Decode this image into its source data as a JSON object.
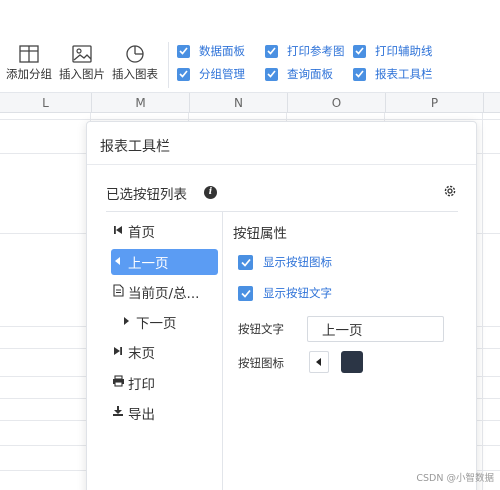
{
  "ribbon": {
    "buttons": [
      {
        "label": "添加分组",
        "icon": "add-group-icon"
      },
      {
        "label": "插入图片",
        "icon": "insert-image-icon"
      },
      {
        "label": "插入图表",
        "icon": "insert-chart-icon"
      }
    ],
    "checkboxes": [
      {
        "label": "数据面板",
        "checked": true
      },
      {
        "label": "打印参考图",
        "checked": true
      },
      {
        "label": "打印辅助线",
        "checked": true
      },
      {
        "label": "分组管理",
        "checked": true
      },
      {
        "label": "查询面板",
        "checked": true
      },
      {
        "label": "报表工具栏",
        "checked": true
      }
    ]
  },
  "columns": [
    "L",
    "M",
    "N",
    "O",
    "P"
  ],
  "panel": {
    "title": "报表工具栏",
    "selected_list_label": "已选按钮列表",
    "buttons": [
      {
        "label": "首页",
        "icon": "first-page-icon",
        "active": false
      },
      {
        "label": "上一页",
        "icon": "prev-page-icon",
        "active": true
      },
      {
        "label": "当前页/总...",
        "icon": "current-page-icon",
        "active": false
      },
      {
        "label": "下一页",
        "icon": "next-page-icon",
        "active": false
      },
      {
        "label": "末页",
        "icon": "last-page-icon",
        "active": false
      },
      {
        "label": "打印",
        "icon": "print-icon",
        "active": false
      },
      {
        "label": "导出",
        "icon": "export-icon",
        "active": false
      }
    ],
    "props": {
      "title": "按钮属性",
      "show_icon_label": "显示按钮图标",
      "show_icon_checked": true,
      "show_text_label": "显示按钮文字",
      "show_text_checked": true,
      "text_label": "按钮文字",
      "text_value": "上一页",
      "icon_label": "按钮图标",
      "icon_value": "prev-page-icon",
      "icon_color": "#2b3545"
    }
  },
  "colors": {
    "accent": "#4a90e2",
    "active_item": "#5b9cf3",
    "link_text": "#2f73d8"
  },
  "watermark": "CSDN @小智数据"
}
